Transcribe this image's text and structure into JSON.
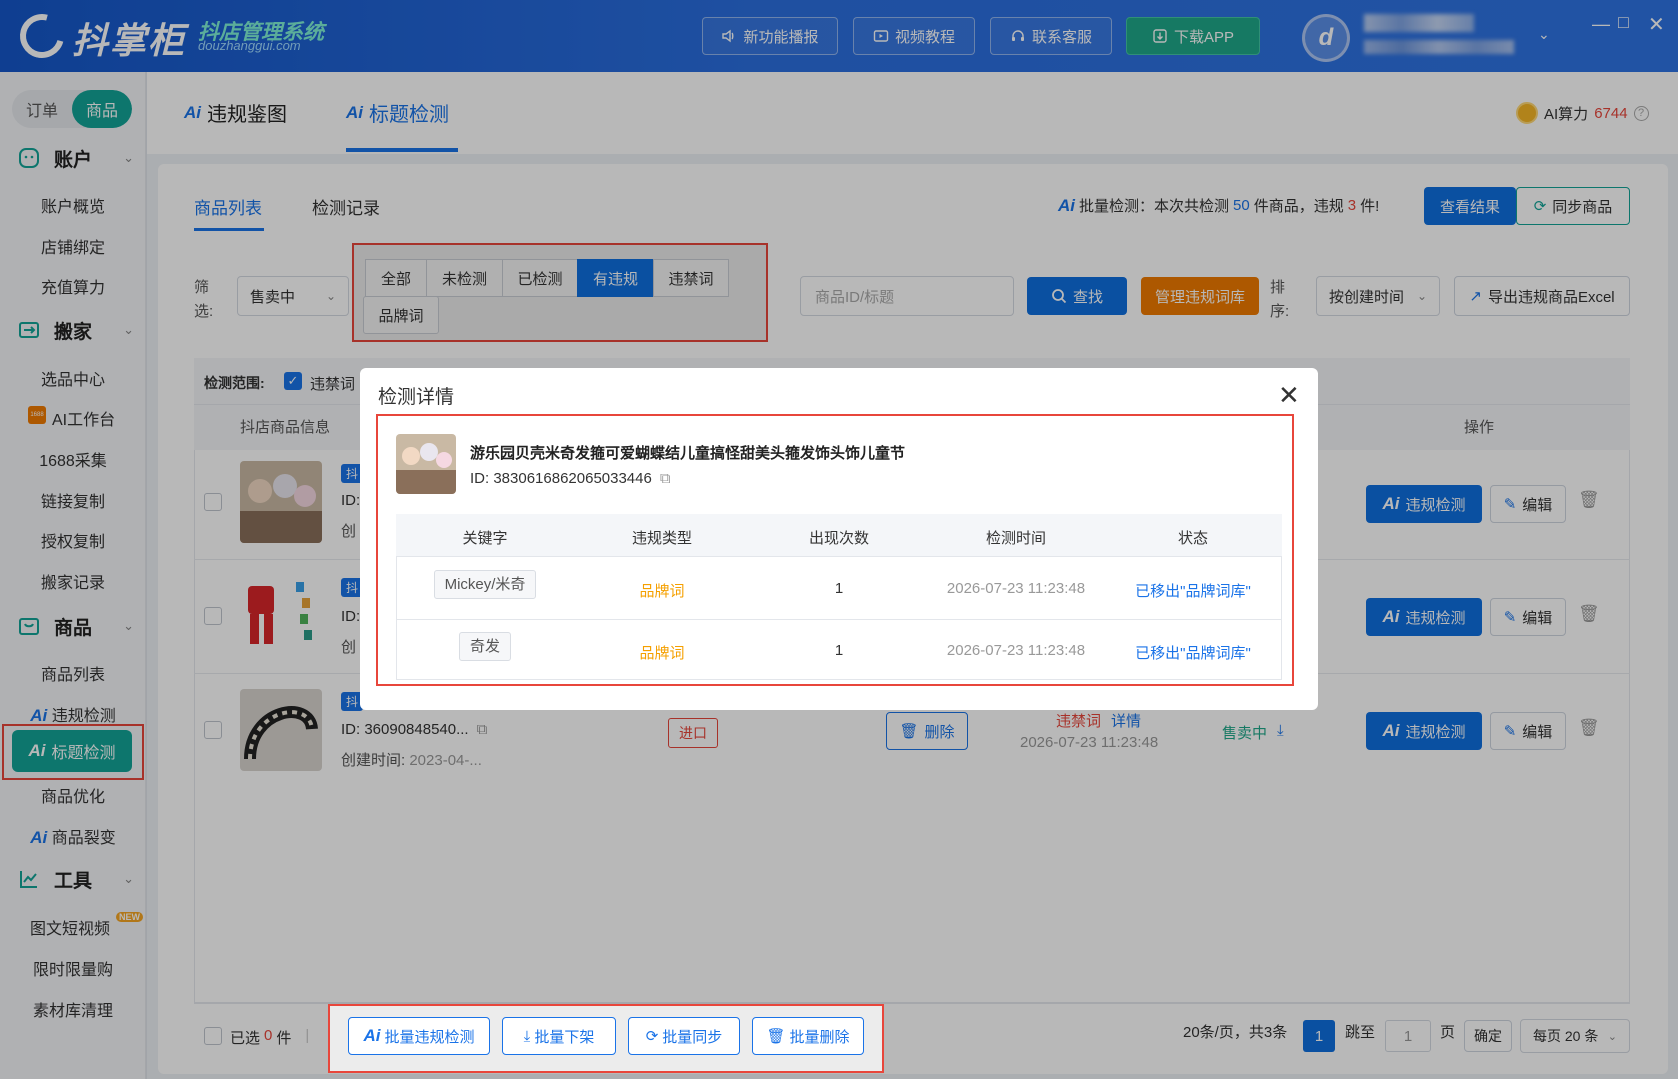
{
  "app": {
    "brand": "抖掌柜",
    "brand_sub": "抖店管理系统",
    "brand_url": "douzhanggui.com"
  },
  "topbar": {
    "buttons": [
      "新功能播报",
      "视频教程",
      "联系客服",
      "下载APP"
    ]
  },
  "sidebar": {
    "seg": [
      "订单",
      "商品"
    ],
    "groups": [
      {
        "label": "账户",
        "items": [
          "账户概览",
          "店铺绑定",
          "充值算力"
        ]
      },
      {
        "label": "搬家",
        "items": [
          "选品中心",
          "AI工作台",
          "1688采集",
          "链接复制",
          "授权复制",
          "搬家记录"
        ]
      },
      {
        "label": "商品",
        "items": [
          "商品列表",
          "违规检测",
          "标题检测",
          "商品优化",
          "商品裂变"
        ]
      },
      {
        "label": "工具",
        "items": [
          "图文短视频",
          "限时限量购",
          "素材库清理"
        ]
      }
    ],
    "new_badge": "NEW",
    "badge_1688": "1688"
  },
  "page": {
    "tabs": [
      "违规鉴图",
      "标题检测"
    ],
    "ai_power_label": "AI算力",
    "ai_power_value": "6744"
  },
  "card": {
    "tabs": [
      "商品列表",
      "检测记录"
    ],
    "batch": {
      "prefix": "批量检测：本次共检测",
      "count": "50",
      "mid": "件商品，违规",
      "violations": "3",
      "suffix": "件!"
    },
    "view_result": "查看结果",
    "sync_goods": "同步商品",
    "filter_label": "筛选:",
    "filter_select": "售卖中",
    "filter_tabs": [
      "全部",
      "未检测",
      "已检测",
      "有违规",
      "违禁词",
      "品牌词"
    ],
    "search_placeholder": "商品ID/标题",
    "search_btn": "查找",
    "manage_btn": "管理违规词库",
    "sort_label": "排序:",
    "sort_select": "按创建时间",
    "export_btn": "导出违规商品Excel",
    "scope_label": "检测范围:",
    "scope_item": "违禁词",
    "headers": {
      "info": "抖店商品信息",
      "op": "操作"
    },
    "row_prefix": "抖",
    "row_id_prefix": "ID:",
    "row_created_prefix": "创",
    "row3": {
      "id": "ID: 36090848540...",
      "created": "创建时间:",
      "created_val": "2023-04-...",
      "tag": "进口",
      "delete": "删除",
      "violation": "违禁词",
      "detail": "详情",
      "time": "2026-07-23 11:23:48",
      "status": "售卖中"
    },
    "row_actions": {
      "detect": "违规检测",
      "edit": "编辑"
    }
  },
  "modal": {
    "title": "检测详情",
    "product_name": "游乐园贝壳米奇发箍可爱蝴蝶结儿童搞怪甜美头箍发饰头饰儿童节",
    "product_id": "ID: 3830616862065033446",
    "columns": [
      "关键字",
      "违规类型",
      "出现次数",
      "检测时间",
      "状态"
    ],
    "rows": [
      {
        "keyword": "Mickey/米奇",
        "type": "品牌词",
        "count": "1",
        "time": "2026-07-23 11:23:48",
        "status": "已移出\"品牌词库\""
      },
      {
        "keyword": "奇发",
        "type": "品牌词",
        "count": "1",
        "time": "2026-07-23 11:23:48",
        "status": "已移出\"品牌词库\""
      }
    ]
  },
  "footer": {
    "selected_prefix": "已选",
    "selected_count": "0",
    "selected_suffix": "件",
    "batch_buttons": [
      "批量违规检测",
      "批量下架",
      "批量同步",
      "批量删除"
    ],
    "page_info": "20条/页，共3条",
    "current_page": "1",
    "jump_label": "跳至",
    "jump_value": "1",
    "page_unit": "页",
    "confirm": "确定",
    "page_size": "每页 20 条"
  },
  "colors": {
    "primary": "#0f6fe0",
    "teal": "#13a497",
    "orange": "#f07a00",
    "red": "#e8463b"
  }
}
